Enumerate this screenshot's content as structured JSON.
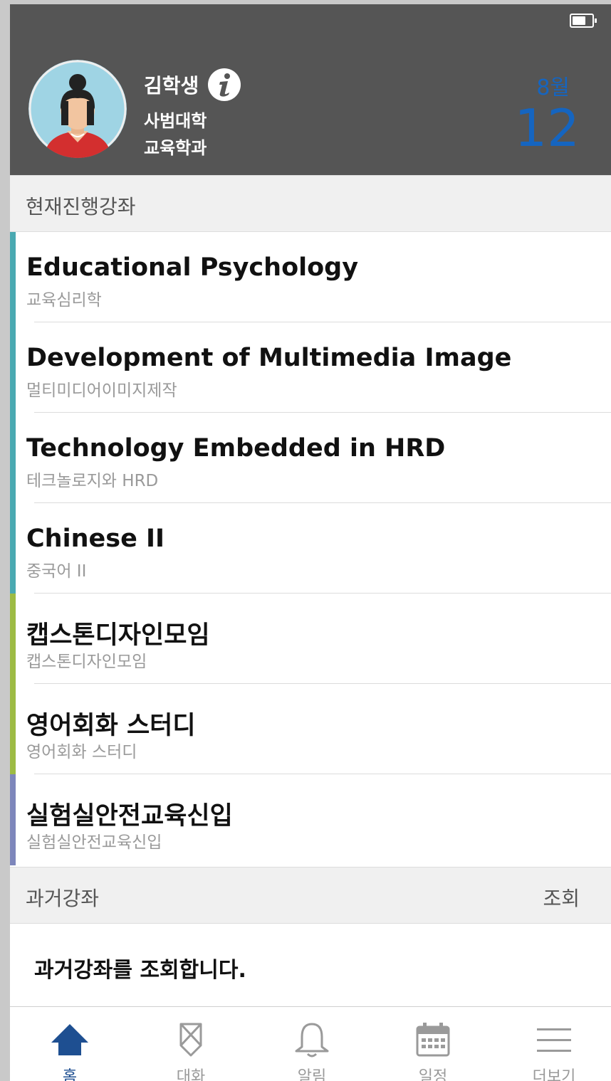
{
  "colors": {
    "header_bg": "#555555",
    "date_blue": "#1565c0",
    "active_tab": "#1e4f91",
    "course_bar_teal": "#4aa9b1",
    "course_bar_green": "#9dbb44",
    "course_bar_purple": "#7d86bb"
  },
  "profile": {
    "name": "김학생",
    "college": "사범대학",
    "department": "교육학과",
    "icon": "info-icon"
  },
  "date": {
    "month": "8월",
    "day": "12"
  },
  "current_section": {
    "title": "현재진행강좌"
  },
  "courses": [
    {
      "title": "Educational Psychology",
      "subtitle": "교육심리학",
      "bar_color": "#4aa9b1"
    },
    {
      "title": "Development of Multimedia Image",
      "subtitle": "멀티미디어이미지제작",
      "bar_color": "#4aa9b1"
    },
    {
      "title": "Technology Embedded in HRD",
      "subtitle": "테크놀로지와 HRD",
      "bar_color": "#4aa9b1"
    },
    {
      "title": "Chinese II",
      "subtitle": "중국어 II",
      "bar_color": "#4aa9b1"
    },
    {
      "title": "캡스톤디자인모임",
      "subtitle": "캡스톤디자인모임",
      "bar_color": "#9dbb44"
    },
    {
      "title": "영어회화 스터디",
      "subtitle": "영어회화 스터디",
      "bar_color": "#9dbb44"
    },
    {
      "title": "실험실안전교육신입",
      "subtitle": "실험실안전교육신입",
      "bar_color": "#7d86bb"
    }
  ],
  "past_section": {
    "title": "과거강좌",
    "action": "조회",
    "body": "과거강좌를 조회합니다."
  },
  "tabs": [
    {
      "label": "홈",
      "icon": "home-icon",
      "active": true
    },
    {
      "label": "대화",
      "icon": "chat-icon",
      "active": false
    },
    {
      "label": "알림",
      "icon": "bell-icon",
      "active": false
    },
    {
      "label": "일정",
      "icon": "calendar-icon",
      "active": false
    },
    {
      "label": "더보기",
      "icon": "menu-icon",
      "active": false
    }
  ]
}
